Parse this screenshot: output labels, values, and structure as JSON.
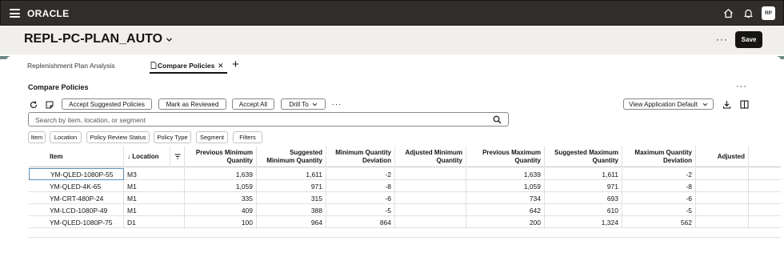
{
  "header": {
    "brand": "ORACLE",
    "avatar_initials": "RP",
    "page_title": "REPL-PC-PLAN_AUTO",
    "more_label": "···",
    "save_label": "Save"
  },
  "tabs": [
    {
      "label": "Replenishment Plan Analysis",
      "active": false
    },
    {
      "label": "Compare Policies",
      "active": true
    }
  ],
  "section": {
    "title": "Compare Policies",
    "more_label": "···"
  },
  "toolbar": {
    "accept_suggested": "Accept Suggested Policies",
    "mark_reviewed": "Mark as Reviewed",
    "accept_all": "Accept All",
    "drill_to": "Drill To",
    "more_label": "···",
    "view_select": "View Application Default"
  },
  "search": {
    "placeholder": "Search by item, location, or segment",
    "value": ""
  },
  "filters": [
    "Item",
    "Location",
    "Policy Review Status",
    "Policy Type",
    "Segment",
    "Filters"
  ],
  "table": {
    "columns": [
      "Item",
      "↓ Location",
      "",
      "Previous Minimum Quantity",
      "Suggested Minimum Quantity",
      "Minimum Quantity Deviation",
      "Adjusted Minimum Quantity",
      "Previous Maximum Quantity",
      "Suggested Maximum Quantity",
      "Maximum Quantity Deviation",
      "Adjusted"
    ],
    "rows": [
      [
        "YM-QLED-1080P-55",
        "M3",
        "1,639",
        "1,611",
        "-2",
        "",
        "1,639",
        "1,611",
        "-2",
        ""
      ],
      [
        "YM-QLED-4K-65",
        "M1",
        "1,059",
        "971",
        "-8",
        "",
        "1,059",
        "971",
        "-8",
        ""
      ],
      [
        "YM-CRT-480P-24",
        "M1",
        "335",
        "315",
        "-6",
        "",
        "734",
        "693",
        "-6",
        ""
      ],
      [
        "YM-LCD-1080P-49",
        "M1",
        "409",
        "388",
        "-5",
        "",
        "642",
        "610",
        "-5",
        ""
      ],
      [
        "YM-QLED-1080P-75",
        "D1",
        "100",
        "964",
        "864",
        "",
        "200",
        "1,324",
        "562",
        ""
      ]
    ]
  },
  "colors": {
    "topbar": "#312d2a",
    "header_bg": "#f1efed",
    "selection_border": "#5f8fb6",
    "save_button": "#161513"
  },
  "icons": [
    "menu-icon",
    "home-icon",
    "bell-icon",
    "refresh-icon",
    "note-icon",
    "chevron-down-icon",
    "search-icon",
    "download-icon",
    "columns-icon",
    "filter-icon"
  ]
}
